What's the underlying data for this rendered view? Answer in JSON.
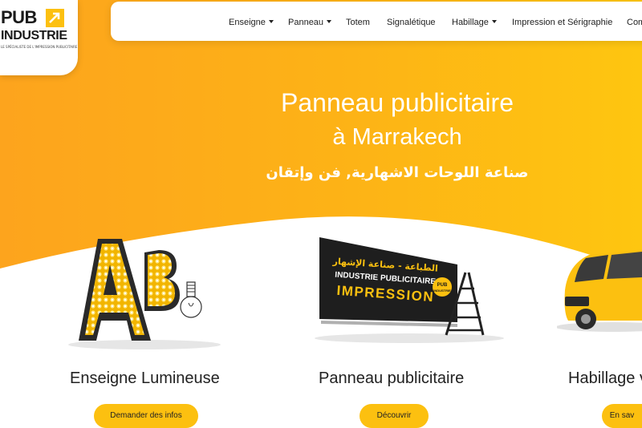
{
  "logo": {
    "line1": "PUB",
    "line2": "INDUSTRIE",
    "tagline": "LE SPÉCIALISTE DE L'IMPRESSION PUBLICITAIRE"
  },
  "nav": {
    "items": [
      {
        "label": "Enseigne",
        "dropdown": true
      },
      {
        "label": "Panneau",
        "dropdown": true
      },
      {
        "label": "Totem",
        "dropdown": false
      },
      {
        "label": "Signalétique",
        "dropdown": false
      },
      {
        "label": "Habillage",
        "dropdown": true
      },
      {
        "label": "Impression et Sérigraphie",
        "dropdown": false
      },
      {
        "label": "Com",
        "dropdown": false
      }
    ]
  },
  "hero": {
    "title": "Panneau publicitaire",
    "subtitle": "à Marrakech",
    "arabic": "صناعة اللوحات الاشهارية, فن وإتقان"
  },
  "panel": {
    "arabic": "الطباعة - صناعة الإشهار",
    "line1": "INDUSTRIE PUBLICITAIRE",
    "line2": "IMPRESSION",
    "badge_line1": "PUB",
    "badge_line2": "INDUSTRIE"
  },
  "sign": {
    "letters": "AB"
  },
  "cards": [
    {
      "title": "Enseigne Lumineuse",
      "button": "Demander des infos"
    },
    {
      "title": "Panneau publicitaire",
      "button": "Découvrir"
    },
    {
      "title": "Habillage v",
      "button": "En sav"
    }
  ],
  "colors": {
    "brand_yellow": "#fcc010",
    "hero_orange": "#fba91b",
    "dark": "#1a1a1a"
  }
}
